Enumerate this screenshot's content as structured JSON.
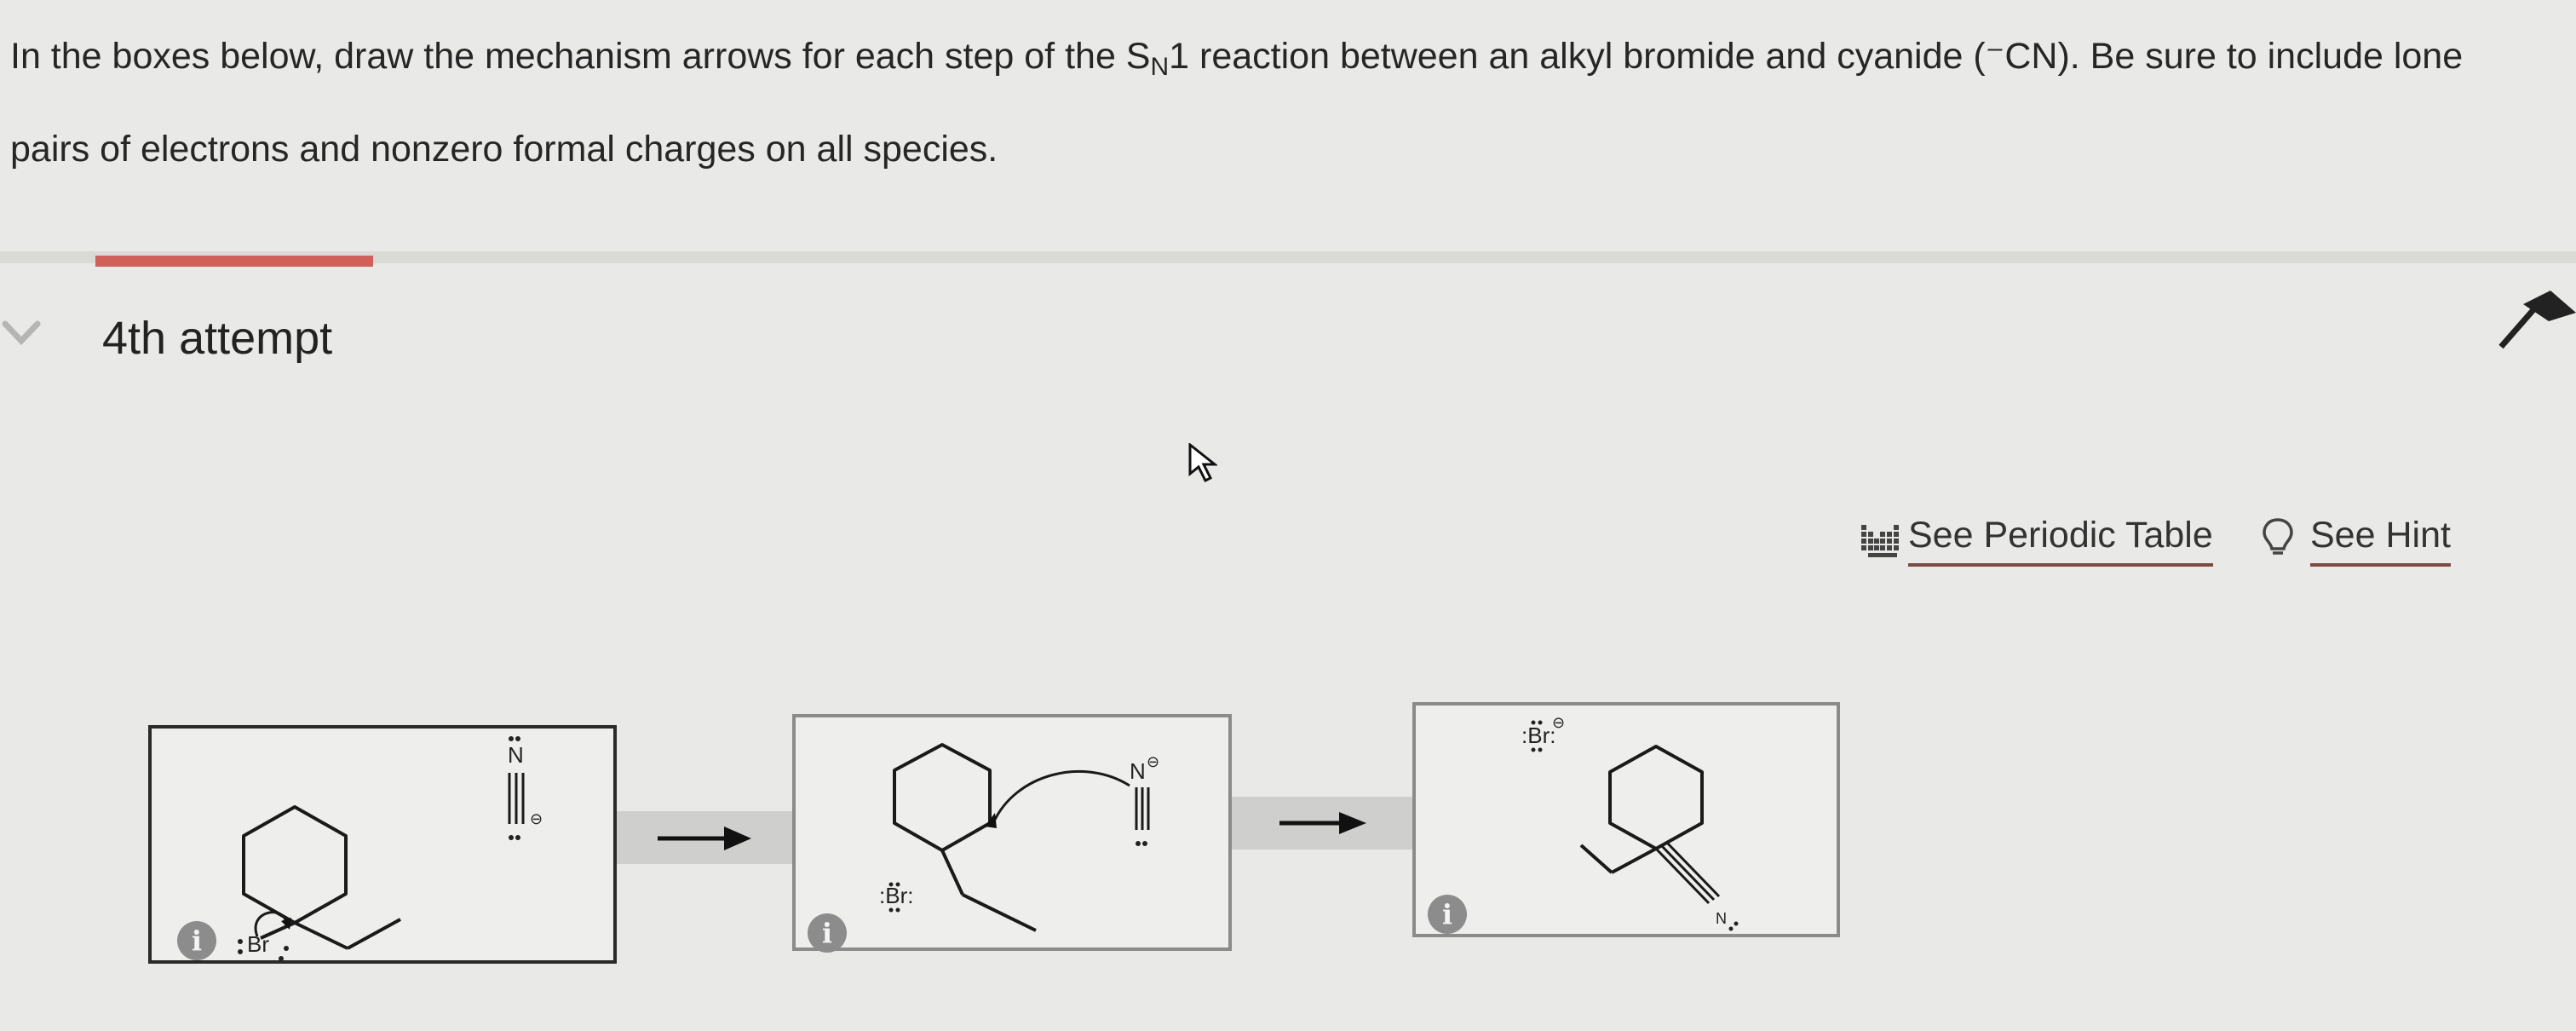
{
  "question": {
    "line1_before_sub": "In the boxes below, draw the mechanism arrows for each step of the S",
    "subscript": "N",
    "line1_after_sub": "1 reaction between an alkyl bromide and cyanide (⁻CN). Be sure to include lone",
    "line2": "pairs of electrons and nonzero formal charges on all species."
  },
  "attempt": {
    "label": "4th attempt"
  },
  "links": {
    "periodic_table": "See Periodic Table",
    "hint": "See Hint"
  },
  "colors": {
    "accent": "#d0605a",
    "link_underline": "#7d4b45",
    "box_border_dark": "#2a2a2a"
  },
  "boxes": [
    {
      "atoms": {
        "br": "Br",
        "n": "N",
        "minus": "⊖"
      }
    },
    {
      "atoms": {
        "br": ":Br:",
        "n": "N",
        "minus": "⊖"
      }
    },
    {
      "atoms": {
        "br": ":Br:",
        "n": "N",
        "minus": "⊖"
      }
    }
  ],
  "info_label": "i",
  "icons": [
    "chevron-down-icon",
    "collapse-arrow-icon",
    "cursor-icon",
    "periodic-table-icon",
    "lightbulb-icon",
    "info-icon",
    "right-arrow-icon"
  ]
}
